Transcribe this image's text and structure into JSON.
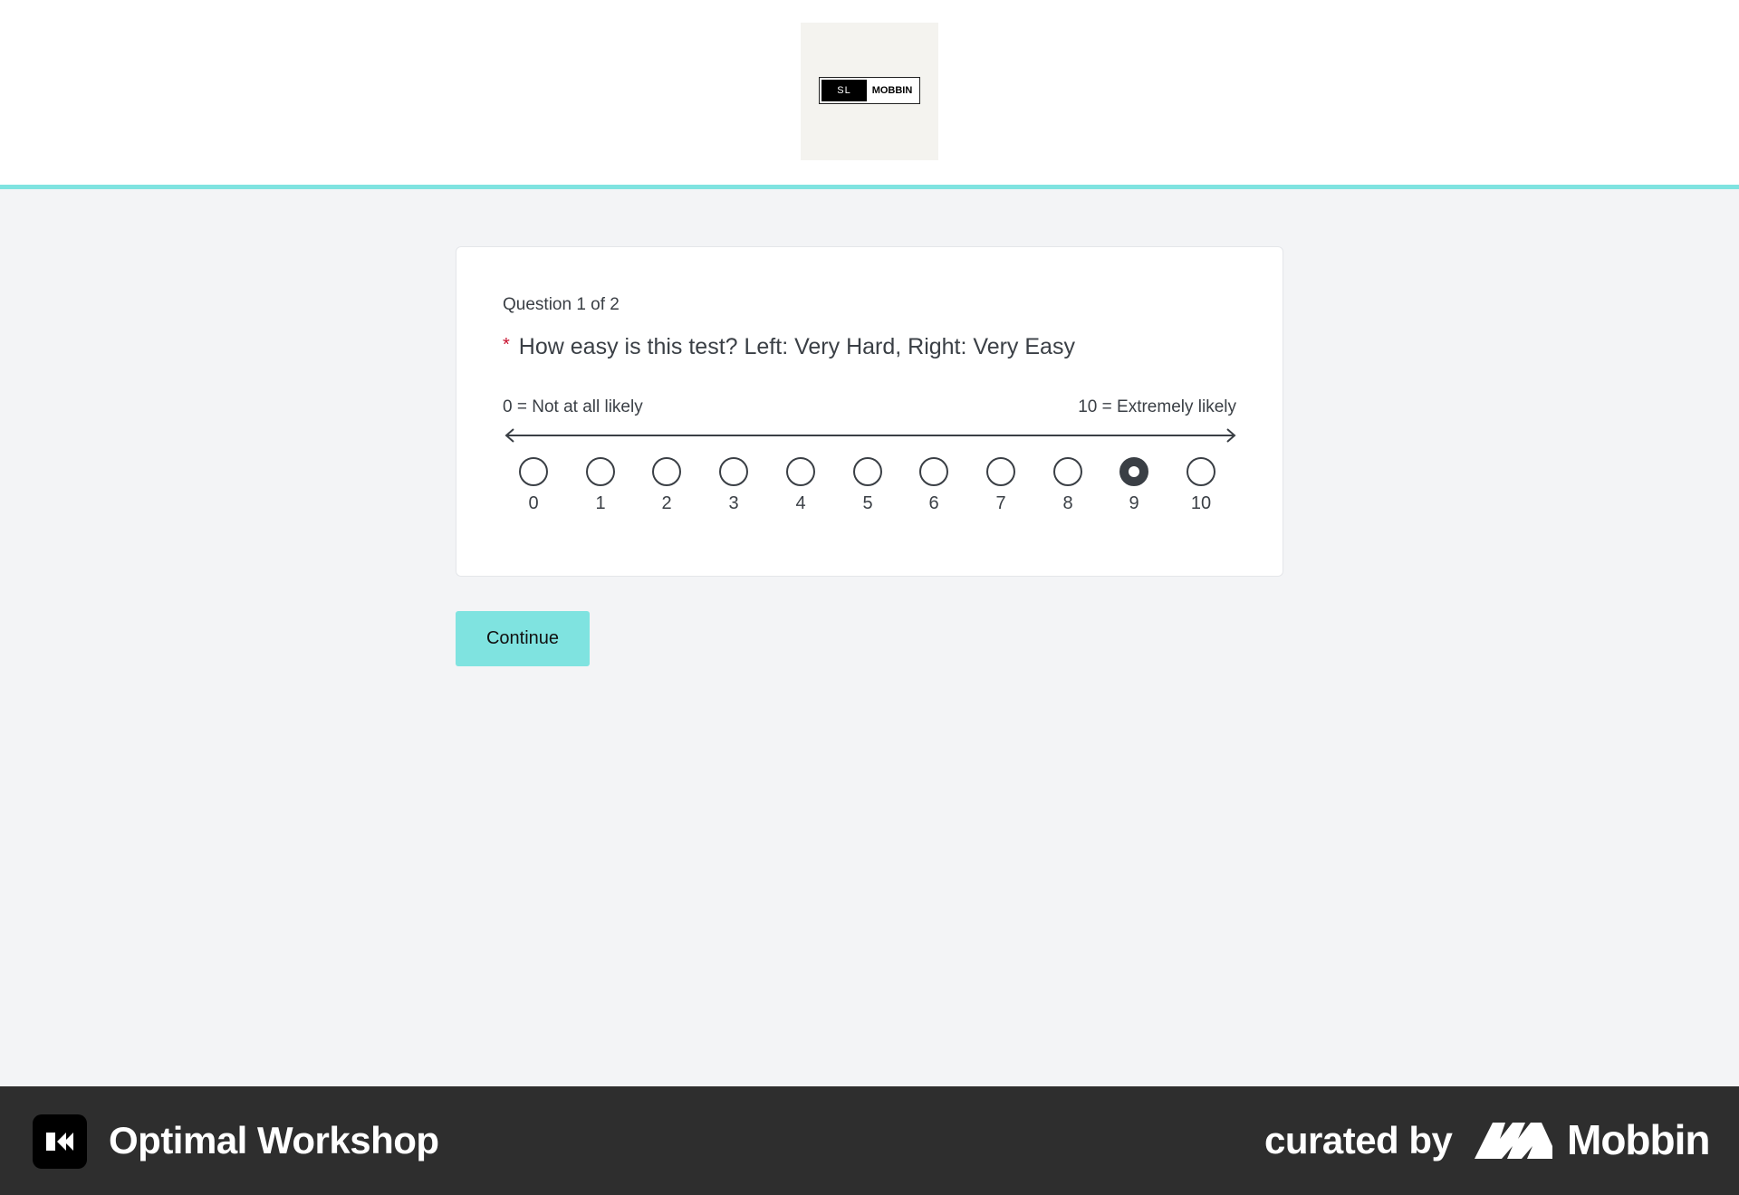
{
  "header": {
    "logo": {
      "left_text": "SL",
      "right_text": "MOBBIN"
    },
    "accent_color": "#7fe3e0"
  },
  "question": {
    "counter": "Question 1 of 2",
    "required_marker": "*",
    "title": "How easy is this test? Left: Very Hard, Right: Very Easy",
    "scale": {
      "min_label": "0 = Not at all likely",
      "max_label": "10 = Extremely likely",
      "options": [
        "0",
        "1",
        "2",
        "3",
        "4",
        "5",
        "6",
        "7",
        "8",
        "9",
        "10"
      ],
      "selected": "9"
    }
  },
  "actions": {
    "continue_label": "Continue"
  },
  "footer": {
    "app_name": "Optimal Workshop",
    "curated_by": "curated by",
    "brand": "Mobbin"
  }
}
